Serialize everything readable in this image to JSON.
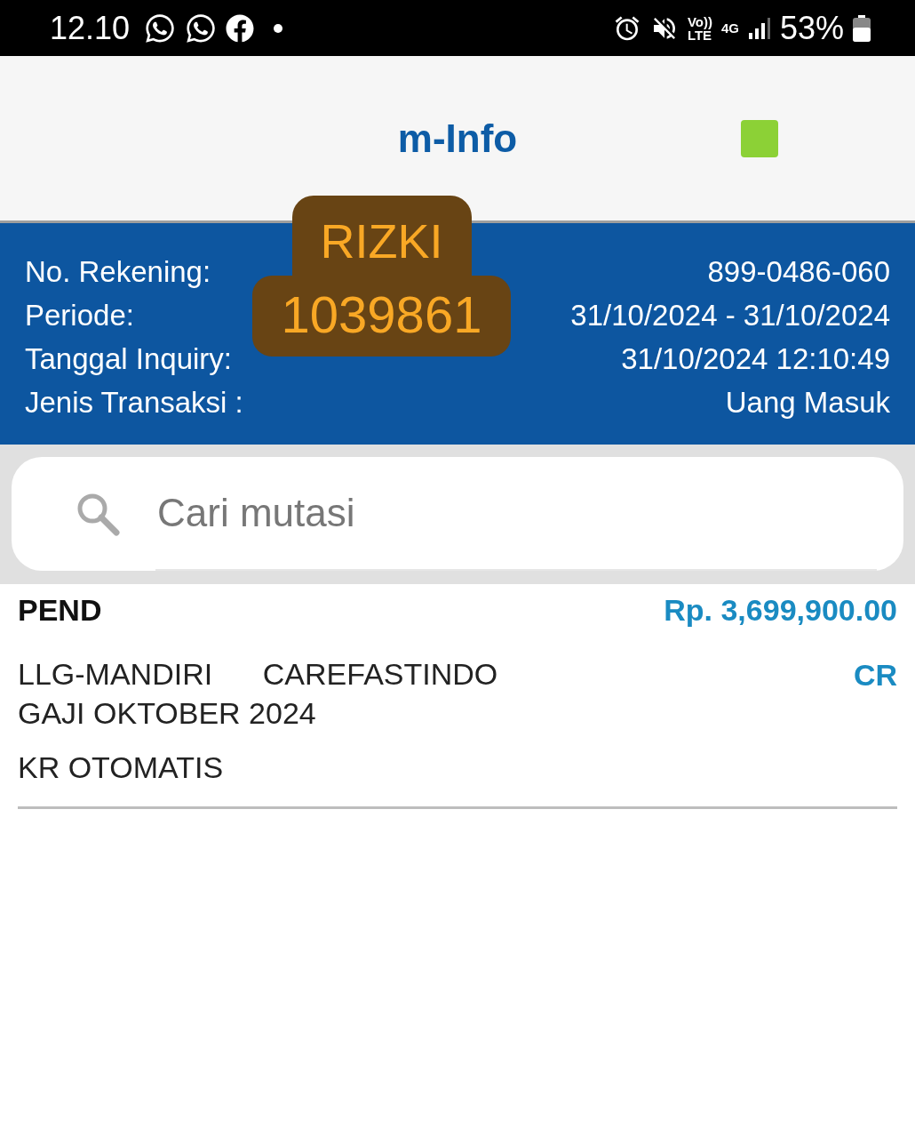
{
  "status_bar": {
    "time": "12.10",
    "volte": "Vo))",
    "lte": "LTE",
    "network": "4G",
    "battery": "53%"
  },
  "header": {
    "title": "m-Info"
  },
  "overlay_label": {
    "lines": [
      "RIZKI",
      "1039861"
    ]
  },
  "account_info": [
    {
      "label": "No. Rekening:",
      "value": "899-0486-060"
    },
    {
      "label": "Periode:",
      "value": "31/10/2024 - 31/10/2024"
    },
    {
      "label": "Tanggal Inquiry:",
      "value": "31/10/2024 12:10:49"
    },
    {
      "label": "Jenis Transaksi :",
      "value": "Uang Masuk"
    }
  ],
  "search": {
    "placeholder": "Cari mutasi"
  },
  "transactions": [
    {
      "status": "PEND",
      "amount": "Rp. 3,699,900.00",
      "description_lines": [
        "LLG-MANDIRI      CAREFASTINDO",
        "GAJI OKTOBER 2024"
      ],
      "type": "CR",
      "note": "KR OTOMATIS"
    }
  ]
}
